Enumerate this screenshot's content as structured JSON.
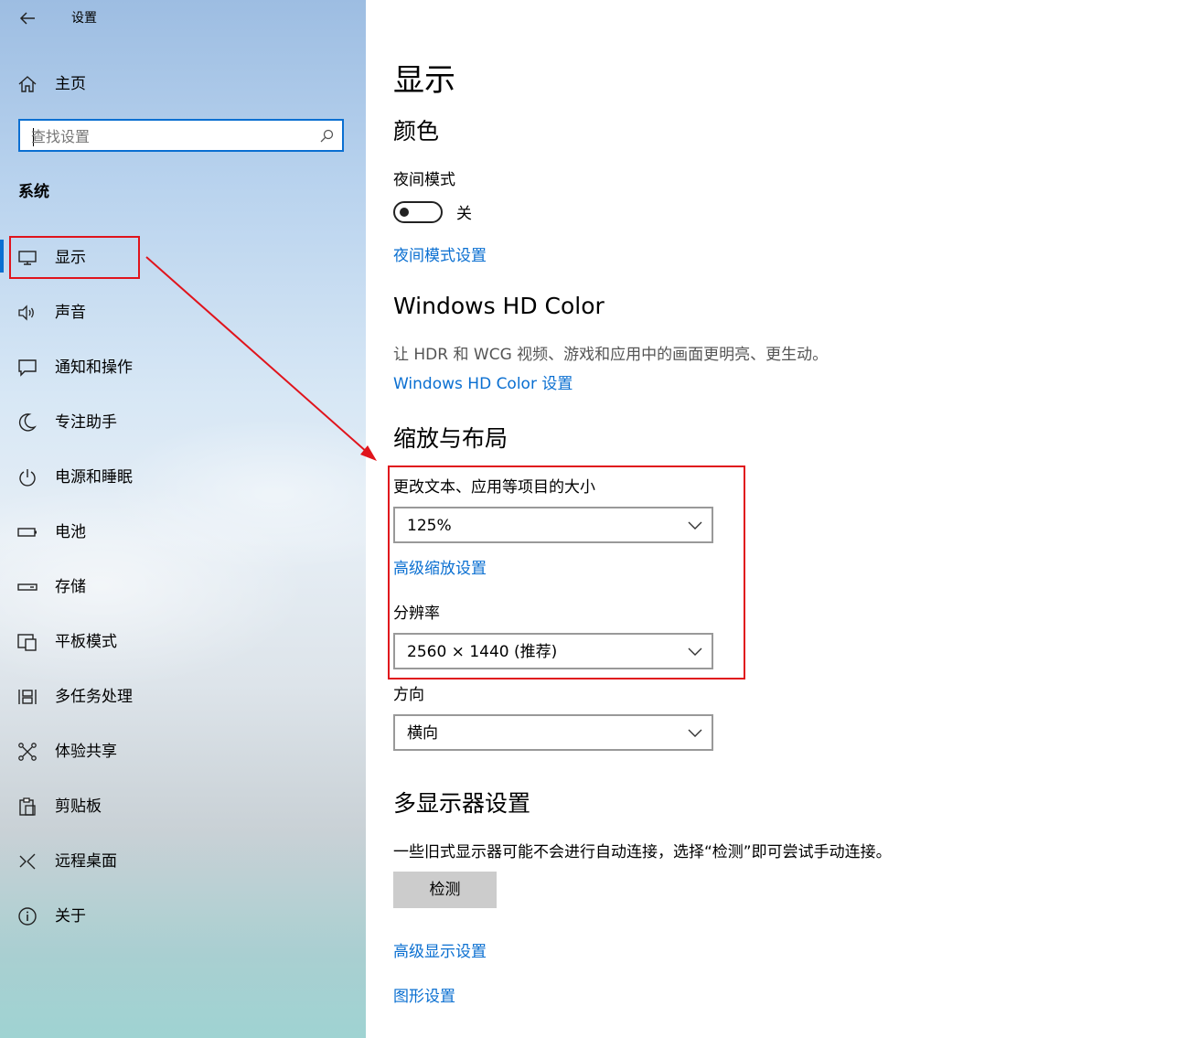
{
  "app": {
    "title": "设置"
  },
  "sidebar": {
    "home_label": "主页",
    "search_placeholder": "查找设置",
    "section_title": "系统",
    "items": [
      {
        "label": "显示",
        "icon": "monitor-icon"
      },
      {
        "label": "声音",
        "icon": "speaker-icon"
      },
      {
        "label": "通知和操作",
        "icon": "message-icon"
      },
      {
        "label": "专注助手",
        "icon": "moon-icon"
      },
      {
        "label": "电源和睡眠",
        "icon": "power-icon"
      },
      {
        "label": "电池",
        "icon": "battery-icon"
      },
      {
        "label": "存储",
        "icon": "storage-icon"
      },
      {
        "label": "平板模式",
        "icon": "tablet-icon"
      },
      {
        "label": "多任务处理",
        "icon": "multitask-icon"
      },
      {
        "label": "体验共享",
        "icon": "share-icon"
      },
      {
        "label": "剪贴板",
        "icon": "clipboard-icon"
      },
      {
        "label": "远程桌面",
        "icon": "remote-icon"
      },
      {
        "label": "关于",
        "icon": "info-icon"
      }
    ],
    "active_item": "显示"
  },
  "main": {
    "page_title": "显示",
    "color_section": "颜色",
    "night_mode_label": "夜间模式",
    "night_mode_state": "关",
    "night_mode_on": false,
    "night_mode_link": "夜间模式设置",
    "hd_color_title": "Windows HD Color",
    "hd_color_desc": "让 HDR 和 WCG 视频、游戏和应用中的画面更明亮、更生动。",
    "hd_color_link": "Windows HD Color 设置",
    "scale_section": "缩放与布局",
    "scale_label": "更改文本、应用等项目的大小",
    "scale_value": "125%",
    "advanced_scale_link": "高级缩放设置",
    "resolution_label": "分辨率",
    "resolution_value": "2560 × 1440 (推荐)",
    "orientation_label": "方向",
    "orientation_value": "横向",
    "multi_display_section": "多显示器设置",
    "multi_display_desc": "一些旧式显示器可能不会进行自动连接，选择“检测”即可尝试手动连接。",
    "detect_button": "检测",
    "advanced_display_link": "高级显示设置",
    "graphics_link": "图形设置"
  },
  "annotation": {
    "color": "#e0141c"
  },
  "colors": {
    "accent": "#0a6fd1"
  }
}
